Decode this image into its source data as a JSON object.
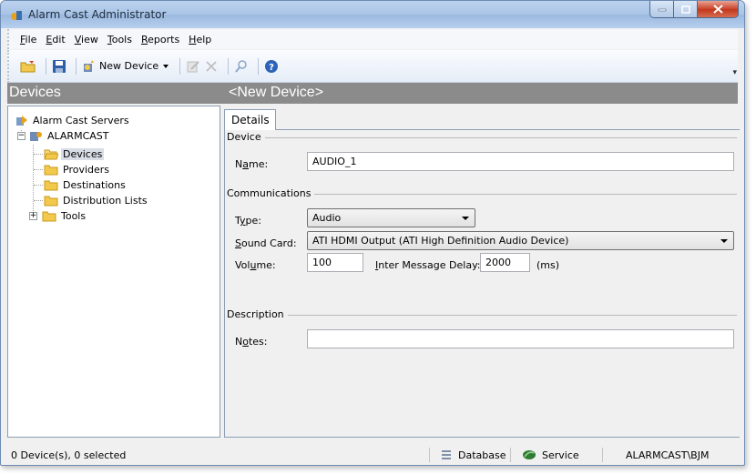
{
  "window": {
    "title": "Alarm Cast Administrator"
  },
  "menu": {
    "items": [
      {
        "accel": "F",
        "rest": "ile"
      },
      {
        "accel": "E",
        "rest": "dit"
      },
      {
        "accel": "V",
        "rest": "iew"
      },
      {
        "accel": "T",
        "rest": "ools"
      },
      {
        "accel": "R",
        "rest": "eports"
      },
      {
        "accel": "H",
        "rest": "elp"
      }
    ]
  },
  "toolbar": {
    "new_device_label": "New Device",
    "icons": [
      "open-icon",
      "save-icon",
      "new-device-icon",
      "edit-icon",
      "delete-icon",
      "search-icon",
      "help-icon"
    ]
  },
  "panels": {
    "left_header": "Devices",
    "right_header": "<New Device>"
  },
  "tree": {
    "root": "Alarm Cast Servers",
    "server": "ALARMCAST",
    "children": [
      "Devices",
      "Providers",
      "Destinations",
      "Distribution Lists",
      "Tools"
    ],
    "selected": "Devices"
  },
  "details": {
    "tab_label": "Details",
    "device_group": "Device",
    "name_label_pre": "N",
    "name_label_accel": "a",
    "name_label_post": "me:",
    "name_value": "AUDIO_1",
    "communications_group": "Communications",
    "type_label_pre": "T",
    "type_label_accel": "y",
    "type_label_post": "pe:",
    "type_value": "Audio",
    "sound_card_label_accel": "S",
    "sound_card_label_post": "ound Card:",
    "sound_card_value": "ATI HDMI Output (ATI High Definition Audio Device)",
    "volume_label_pre": "Vol",
    "volume_label_accel": "u",
    "volume_label_post": "me:",
    "volume_value": "100",
    "delay_label_accel": "I",
    "delay_label_post": "nter Message Delay:",
    "delay_value": "2000",
    "delay_unit": "(ms)",
    "description_group": "Description",
    "notes_label_pre": "N",
    "notes_label_accel": "o",
    "notes_label_post": "tes:",
    "notes_value": ""
  },
  "status": {
    "selection": "0 Device(s), 0 selected",
    "database": "Database",
    "service": "Service",
    "user": "ALARMCAST\\BJM"
  },
  "colors": {
    "header_bg": "#8b8b8b",
    "title_gradient": "#a9c4e6",
    "close_button": "#c9432a",
    "folder": "#f2c94c"
  }
}
